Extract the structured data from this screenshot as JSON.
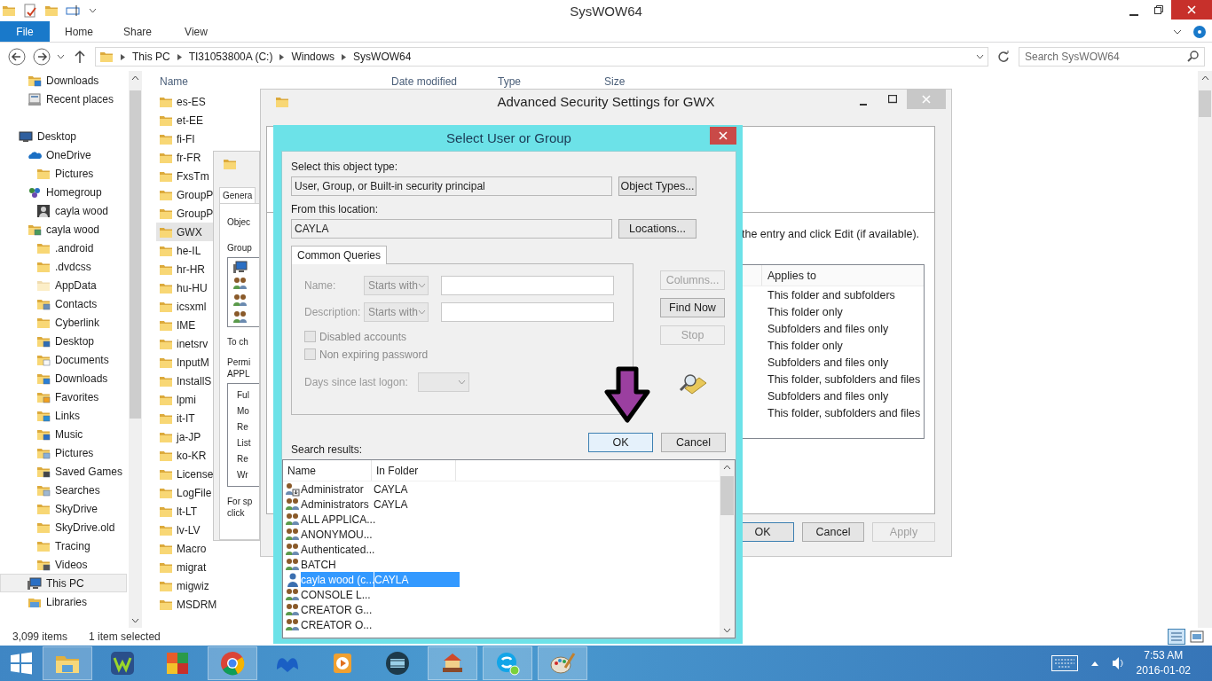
{
  "explorer": {
    "title": "SysWOW64",
    "file_tab": "File",
    "ribbon_tabs": [
      "Home",
      "Share",
      "View"
    ],
    "address": [
      "This PC",
      "TI31053800A (C:)",
      "Windows",
      "SysWOW64"
    ],
    "search": {
      "placeholder": "Search SysWOW64"
    },
    "nav": {
      "pinned": [
        {
          "label": "Downloads",
          "kind": "download",
          "selected": false
        },
        {
          "label": "Recent places",
          "kind": "recent",
          "selected": false
        }
      ],
      "tree": [
        {
          "label": "Desktop",
          "kind": "desktop",
          "selected": false,
          "children": [
            {
              "label": "OneDrive",
              "kind": "cloud",
              "selected": false,
              "children": [
                {
                  "label": "Pictures",
                  "kind": "folder",
                  "selected": false
                }
              ]
            },
            {
              "label": "Homegroup",
              "kind": "network",
              "selected": false,
              "children": [
                {
                  "label": "cayla wood",
                  "kind": "person",
                  "selected": false
                }
              ]
            },
            {
              "label": "cayla wood",
              "kind": "user",
              "selected": false,
              "children": [
                {
                  "label": ".android",
                  "kind": "folder",
                  "selected": false
                },
                {
                  "label": ".dvdcss",
                  "kind": "folder",
                  "selected": false
                },
                {
                  "label": "AppData",
                  "kind": "hidden",
                  "selected": false
                },
                {
                  "label": "Contacts",
                  "kind": "contacts",
                  "selected": false
                },
                {
                  "label": "Cyberlink",
                  "kind": "folder",
                  "selected": false
                },
                {
                  "label": "Desktop",
                  "kind": "desk",
                  "selected": false
                },
                {
                  "label": "Documents",
                  "kind": "documents",
                  "selected": false
                },
                {
                  "label": "Downloads",
                  "kind": "download",
                  "selected": false
                },
                {
                  "label": "Favorites",
                  "kind": "favorites",
                  "selected": false
                },
                {
                  "label": "Links",
                  "kind": "links",
                  "selected": false
                },
                {
                  "label": "Music",
                  "kind": "music",
                  "selected": false
                },
                {
                  "label": "Pictures",
                  "kind": "pictures",
                  "selected": false
                },
                {
                  "label": "Saved Games",
                  "kind": "games",
                  "selected": false
                },
                {
                  "label": "Searches",
                  "kind": "searches",
                  "selected": false
                },
                {
                  "label": "SkyDrive",
                  "kind": "folder",
                  "selected": false
                },
                {
                  "label": "SkyDrive.old",
                  "kind": "folder",
                  "selected": false
                },
                {
                  "label": "Tracing",
                  "kind": "folder",
                  "selected": false
                },
                {
                  "label": "Videos",
                  "kind": "videos",
                  "selected": false
                }
              ]
            },
            {
              "label": "This PC",
              "kind": "computer",
              "selected": true
            },
            {
              "label": "Libraries",
              "kind": "library",
              "selected": false
            }
          ]
        }
      ]
    },
    "columns": [
      "Name",
      "Date modified",
      "Type",
      "Size"
    ],
    "files": [
      {
        "name": "es-ES",
        "selected": false
      },
      {
        "name": "et-EE",
        "selected": false
      },
      {
        "name": "fi-FI",
        "selected": false
      },
      {
        "name": "fr-FR",
        "selected": false
      },
      {
        "name": "FxsTm",
        "selected": false
      },
      {
        "name": "GroupP",
        "selected": false
      },
      {
        "name": "GroupP",
        "selected": false
      },
      {
        "name": "GWX",
        "selected": true
      },
      {
        "name": "he-IL",
        "selected": false
      },
      {
        "name": "hr-HR",
        "selected": false
      },
      {
        "name": "hu-HU",
        "selected": false
      },
      {
        "name": "icsxml",
        "selected": false
      },
      {
        "name": "IME",
        "selected": false
      },
      {
        "name": "inetsrv",
        "selected": false
      },
      {
        "name": "InputM",
        "selected": false
      },
      {
        "name": "InstallS",
        "selected": false
      },
      {
        "name": "lpmi",
        "selected": false
      },
      {
        "name": "it-IT",
        "selected": false
      },
      {
        "name": "ja-JP",
        "selected": false
      },
      {
        "name": "ko-KR",
        "selected": false
      },
      {
        "name": "License",
        "selected": false
      },
      {
        "name": "LogFile",
        "selected": false
      },
      {
        "name": "lt-LT",
        "selected": false
      },
      {
        "name": "lv-LV",
        "selected": false
      },
      {
        "name": "Macro",
        "selected": false
      },
      {
        "name": "migrat",
        "selected": false
      },
      {
        "name": "migwiz",
        "selected": false
      },
      {
        "name": "MSDRM",
        "selected": false
      }
    ],
    "status": {
      "count": "3,099 items",
      "selection": "1 item selected"
    }
  },
  "properties_dialog": {
    "tab": "Genera",
    "object_label": "Objec",
    "group_label": "Group",
    "change_label": "To ch",
    "permissions_label": "Permi",
    "permissions_for": "APPL",
    "permissions": [
      "Ful",
      "Mo",
      "Re",
      "List",
      "Re",
      "Wr"
    ],
    "special_lines": [
      "For sp",
      "click"
    ]
  },
  "advanced_dialog": {
    "title": "Advanced Security Settings for GWX",
    "hint": "the entry and click Edit (if available).",
    "column": "Applies to",
    "entries": [
      "This folder and subfolders",
      "This folder only",
      "Subfolders and files only",
      "This folder only",
      "Subfolders and files only",
      "This folder, subfolders and files",
      "Subfolders and files only",
      "This folder, subfolders and files"
    ],
    "buttons": [
      {
        "label": "OK",
        "disabled": false
      },
      {
        "label": "Cancel",
        "disabled": false
      },
      {
        "label": "Apply",
        "disabled": true
      }
    ]
  },
  "select_dialog": {
    "title": "Select User or Group",
    "object_type": {
      "label": "Select this object type:",
      "value": "User, Group, or Built-in security principal",
      "button": "Object Types..."
    },
    "location": {
      "label": "From this location:",
      "value": "CAYLA",
      "button": "Locations..."
    },
    "query_tab": "Common Queries",
    "queries": [
      {
        "label": "Name:",
        "mode": "Starts with",
        "disabled": true
      },
      {
        "label": "Description:",
        "mode": "Starts with",
        "disabled": true
      }
    ],
    "checkboxes": [
      {
        "label": "Disabled accounts",
        "checked": false,
        "disabled": true
      },
      {
        "label": "Non expiring password",
        "checked": false,
        "disabled": true
      }
    ],
    "days": {
      "label": "Days since last logon:",
      "disabled": true
    },
    "side_buttons": [
      {
        "label": "Columns...",
        "disabled": true
      },
      {
        "label": "Find Now",
        "disabled": false
      },
      {
        "label": "Stop",
        "disabled": true
      }
    ],
    "ok": "OK",
    "cancel": "Cancel",
    "results_label": "Search results:",
    "results_columns": [
      "Name",
      "In Folder"
    ],
    "results": [
      {
        "name": "Administrator",
        "folder": "CAYLA",
        "kind": "admin",
        "selected": false
      },
      {
        "name": "Administrators",
        "folder": "CAYLA",
        "kind": "group",
        "selected": false
      },
      {
        "name": "ALL APPLICA...",
        "kind": "group",
        "selected": false
      },
      {
        "name": "ANONYMOU...",
        "kind": "group",
        "selected": false
      },
      {
        "name": "Authenticated...",
        "kind": "group",
        "selected": false
      },
      {
        "name": "BATCH",
        "kind": "group",
        "selected": false
      },
      {
        "name": "cayla wood (c...",
        "folder": "CAYLA",
        "kind": "user",
        "selected": true
      },
      {
        "name": "CONSOLE L...",
        "kind": "group",
        "selected": false
      },
      {
        "name": "CREATOR G...",
        "kind": "group",
        "selected": false
      },
      {
        "name": "CREATOR O...",
        "kind": "group",
        "selected": false
      }
    ]
  },
  "taskbar": {
    "apps": [
      {
        "kind": "explorer",
        "open": true
      },
      {
        "kind": "zigzag",
        "open": false
      },
      {
        "kind": "tiles",
        "open": false
      },
      {
        "kind": "browser",
        "open": true
      },
      {
        "kind": "wing",
        "open": false
      },
      {
        "kind": "player",
        "open": false
      },
      {
        "kind": "film",
        "open": false
      },
      {
        "kind": "carousel",
        "open": true
      },
      {
        "kind": "chat",
        "open": true
      },
      {
        "kind": "palette",
        "open": true
      }
    ],
    "time": "7:53 AM",
    "date": "2016-01-02"
  }
}
